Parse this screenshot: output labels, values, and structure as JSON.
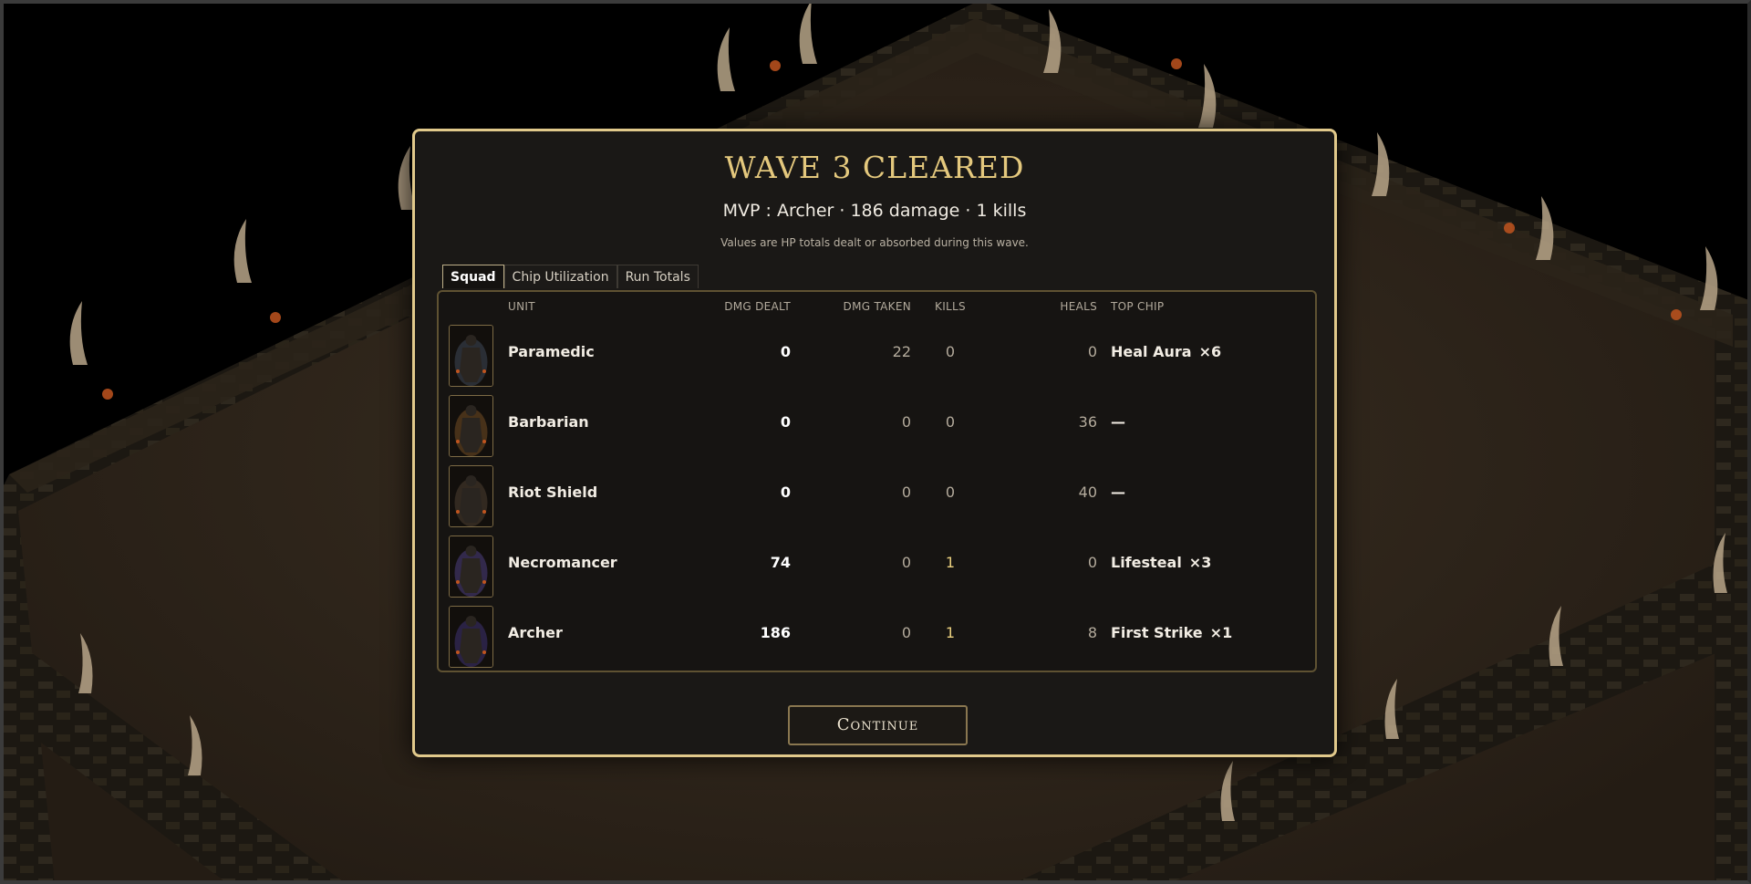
{
  "modal": {
    "title": "WAVE 3 CLEARED",
    "mvp": "MVP : Archer · 186 damage · 1 kills",
    "note": "Values are HP totals dealt or absorbed during this wave.",
    "continue_label": "Continue"
  },
  "tabs": [
    {
      "label": "Squad",
      "active": true
    },
    {
      "label": "Chip Utilization",
      "active": false
    },
    {
      "label": "Run Totals",
      "active": false
    }
  ],
  "table": {
    "headers": {
      "unit": "UNIT",
      "dmg_dealt": "DMG DEALT",
      "dmg_taken": "DMG TAKEN",
      "kills": "KILLS",
      "heals": "HEALS",
      "top_chip": "TOP CHIP"
    },
    "rows": [
      {
        "unit": "Paramedic",
        "dmg_dealt": "0",
        "dmg_taken": "22",
        "kills": "0",
        "heals": "0",
        "top_chip": "Heal Aura",
        "chip_mult": "×6",
        "portrait": "paramedic-portrait",
        "tint": "#4a5568"
      },
      {
        "unit": "Barbarian",
        "dmg_dealt": "0",
        "dmg_taken": "0",
        "kills": "0",
        "heals": "36",
        "top_chip": "—",
        "chip_mult": "",
        "portrait": "barbarian-portrait",
        "tint": "#8a5a2b"
      },
      {
        "unit": "Riot Shield",
        "dmg_dealt": "0",
        "dmg_taken": "0",
        "kills": "0",
        "heals": "40",
        "top_chip": "—",
        "chip_mult": "",
        "portrait": "riot-shield-portrait",
        "tint": "#5a4a3a"
      },
      {
        "unit": "Necromancer",
        "dmg_dealt": "74",
        "dmg_taken": "0",
        "kills": "1",
        "heals": "0",
        "top_chip": "Lifesteal",
        "chip_mult": "×3",
        "portrait": "necromancer-portrait",
        "tint": "#5a4a9a"
      },
      {
        "unit": "Archer",
        "dmg_dealt": "186",
        "dmg_taken": "0",
        "kills": "1",
        "heals": "8",
        "top_chip": "First Strike",
        "chip_mult": "×1",
        "portrait": "archer-portrait",
        "tint": "#4a3a8a"
      }
    ]
  },
  "colors": {
    "accent_gold": "#e4c87d",
    "modal_bg": "#1a1816",
    "kill_highlight": "#ead07f"
  }
}
